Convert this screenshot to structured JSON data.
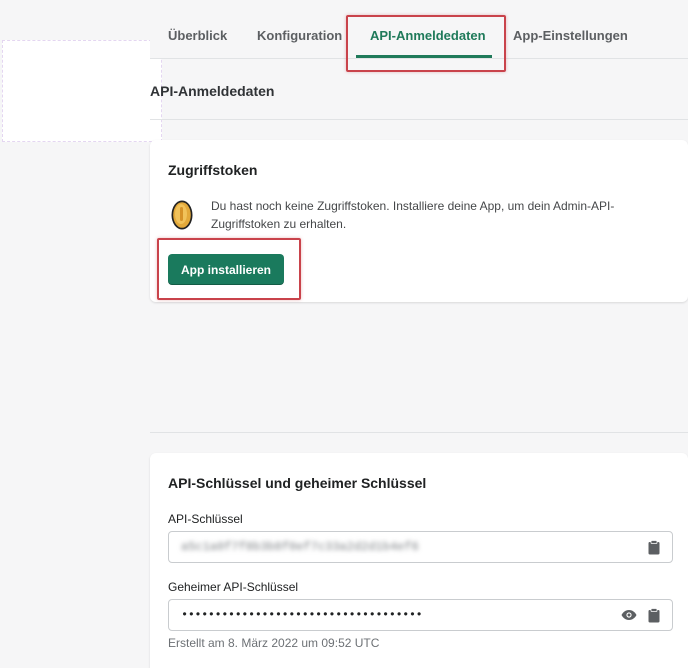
{
  "tabs": [
    {
      "label": "Überblick"
    },
    {
      "label": "Konfiguration"
    },
    {
      "label": "API-Anmeldedaten"
    },
    {
      "label": "App-Einstellungen"
    }
  ],
  "page": {
    "section_title": "API-Anmeldedaten"
  },
  "token_card": {
    "heading": "Zugriffstoken",
    "message_line1": "Du hast noch keine Zugriffstoken. Installiere deine App, um dein Admin-API-",
    "message_line2": "Zugriffstoken zu erhalten.",
    "install_button": "App installieren"
  },
  "keys_card": {
    "heading": "API-Schlüssel und geheimer Schlüssel",
    "api_key_label": "API-Schlüssel",
    "api_key_value": "a5c1a0f7f8b3b8f0ef7c33a2d2d1b4ef6",
    "secret_label": "Geheimer API-Schlüssel",
    "secret_value": "••••••••••••••••••••••••••••••••••••",
    "created": "Erstellt am 8. März 2022 um 09:52 UTC"
  },
  "colors": {
    "accent": "#1f7a5a",
    "button": "#1a7a5d",
    "highlight": "#c9434b"
  }
}
